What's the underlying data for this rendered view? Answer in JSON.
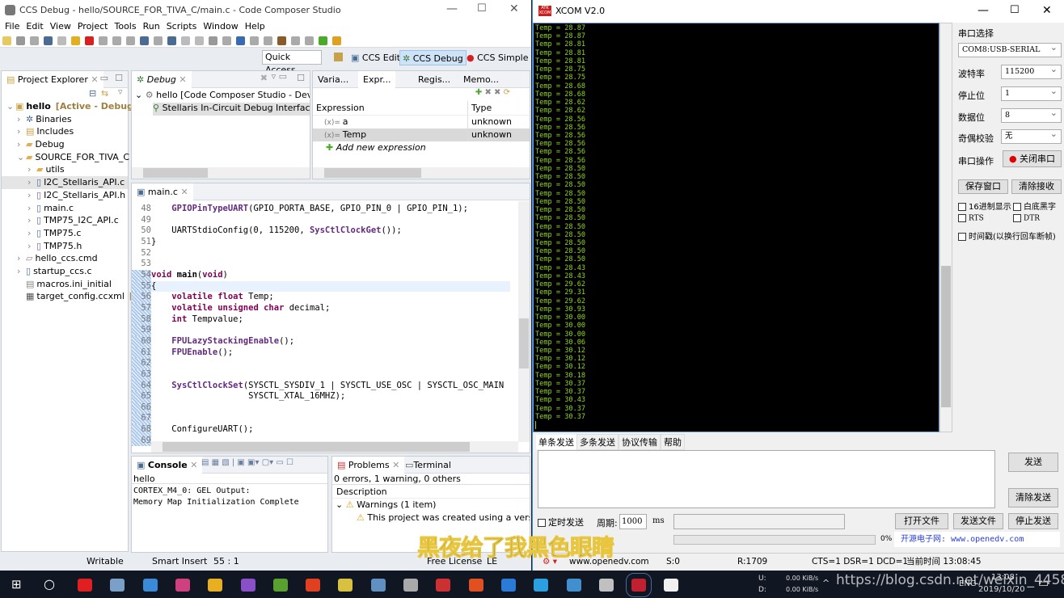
{
  "ccs": {
    "title": "CCS Debug - hello/SOURCE_FOR_TIVA_C/main.c - Code Composer Studio",
    "menu": [
      "File",
      "Edit",
      "View",
      "Project",
      "Tools",
      "Run",
      "Scripts",
      "Window",
      "Help"
    ],
    "quick_access": "Quick Access",
    "perspectives": [
      "CCS Edit",
      "CCS Debug",
      "CCS Simple"
    ],
    "project_explorer": {
      "title": "Project Explorer",
      "items": [
        {
          "label": "hello",
          "suffix": "[Active - Debug]",
          "level": 0,
          "expanded": true,
          "icon": "project-icon"
        },
        {
          "label": "Binaries",
          "level": 1,
          "icon": "binaries-icon"
        },
        {
          "label": "Includes",
          "level": 1,
          "icon": "includes-icon"
        },
        {
          "label": "Debug",
          "level": 1,
          "icon": "folder-icon"
        },
        {
          "label": "SOURCE_FOR_TIVA_C",
          "level": 1,
          "expanded": true,
          "icon": "folder-icon"
        },
        {
          "label": "utils",
          "level": 2,
          "icon": "folder-icon"
        },
        {
          "label": "I2C_Stellaris_API.c",
          "level": 2,
          "icon": "c-file-icon",
          "selected": true
        },
        {
          "label": "I2C_Stellaris_API.h",
          "level": 2,
          "icon": "h-file-icon"
        },
        {
          "label": "main.c",
          "level": 2,
          "icon": "c-file-icon"
        },
        {
          "label": "TMP75_I2C_API.c",
          "level": 2,
          "icon": "c-file-icon"
        },
        {
          "label": "TMP75.c",
          "level": 2,
          "icon": "c-file-icon"
        },
        {
          "label": "TMP75.h",
          "level": 2,
          "icon": "h-file-icon"
        },
        {
          "label": "hello_ccs.cmd",
          "level": 1,
          "icon": "cmd-file-icon"
        },
        {
          "label": "startup_ccs.c",
          "level": 1,
          "icon": "c-file-icon"
        },
        {
          "label": "macros.ini_initial",
          "level": 1,
          "icon": "file-icon",
          "noarrow": true
        },
        {
          "label": "target_config.ccxml",
          "suffix": "[A",
          "level": 1,
          "icon": "config-file-icon",
          "noarrow": true
        }
      ]
    },
    "debug": {
      "title": "Debug",
      "items": [
        "hello [Code Composer Studio - Device",
        "Stellaris In-Circuit Debug Interface_"
      ]
    },
    "views_tabs": [
      "Varia...",
      "Expr...",
      "Regis...",
      "Memo..."
    ],
    "expressions": {
      "headers": [
        "Expression",
        "Type"
      ],
      "rows": [
        {
          "name": "a",
          "type": "unknown"
        },
        {
          "name": "Temp",
          "type": "unknown"
        }
      ],
      "add": "Add new expression"
    },
    "editor": {
      "tab": "main.c",
      "lines": [
        {
          "n": "48",
          "s": [
            {
              "t": "    "
            },
            {
              "t": "GPIOPinTypeUART",
              "c": "fn"
            },
            {
              "t": "(GPIO_PORTA_BASE, GPIO_PIN_0 | GPIO_PIN_1);"
            }
          ]
        },
        {
          "n": "49",
          "s": []
        },
        {
          "n": "50",
          "s": [
            {
              "t": "    UARTStdioConfig(0, 115200, "
            },
            {
              "t": "SysCtlClockGet",
              "c": "fn"
            },
            {
              "t": "());"
            }
          ]
        },
        {
          "n": "51",
          "s": [
            {
              "t": "}"
            }
          ]
        },
        {
          "n": "52",
          "s": []
        },
        {
          "n": "53",
          "s": []
        },
        {
          "n": "54",
          "s": [
            {
              "t": "void",
              "c": "kw"
            },
            {
              "t": " "
            },
            {
              "t": "main",
              "c": "b"
            },
            {
              "t": "("
            },
            {
              "t": "void",
              "c": "kw"
            },
            {
              "t": ")"
            }
          ]
        },
        {
          "n": "55",
          "s": [
            {
              "t": "{"
            }
          ],
          "current": true
        },
        {
          "n": "56",
          "s": [
            {
              "t": "    "
            },
            {
              "t": "volatile",
              "c": "kw"
            },
            {
              "t": " "
            },
            {
              "t": "float",
              "c": "kw"
            },
            {
              "t": " Temp;"
            }
          ]
        },
        {
          "n": "57",
          "s": [
            {
              "t": "    "
            },
            {
              "t": "volatile",
              "c": "kw"
            },
            {
              "t": " "
            },
            {
              "t": "unsigned",
              "c": "kw"
            },
            {
              "t": " "
            },
            {
              "t": "char",
              "c": "kw"
            },
            {
              "t": " decimal;"
            }
          ]
        },
        {
          "n": "58",
          "s": [
            {
              "t": "    "
            },
            {
              "t": "int",
              "c": "kw"
            },
            {
              "t": " Tempvalue;"
            }
          ]
        },
        {
          "n": "59",
          "s": []
        },
        {
          "n": "60",
          "s": [
            {
              "t": "    "
            },
            {
              "t": "FPULazyStackingEnable",
              "c": "fn"
            },
            {
              "t": "();"
            }
          ]
        },
        {
          "n": "61",
          "s": [
            {
              "t": "    "
            },
            {
              "t": "FPUEnable",
              "c": "fn"
            },
            {
              "t": "();"
            }
          ]
        },
        {
          "n": "62",
          "s": []
        },
        {
          "n": "63",
          "s": []
        },
        {
          "n": "64",
          "s": [
            {
              "t": "    "
            },
            {
              "t": "SysCtlClockSet",
              "c": "fn"
            },
            {
              "t": "(SYSCTL_SYSDIV_1 | SYSCTL_USE_OSC | SYSCTL_OSC_MAIN |"
            }
          ]
        },
        {
          "n": "65",
          "s": [
            {
              "t": "                   SYSCTL_XTAL_16MHZ);"
            }
          ]
        },
        {
          "n": "66",
          "s": []
        },
        {
          "n": "67",
          "s": []
        },
        {
          "n": "68",
          "s": [
            {
              "t": "    ConfigureUART();"
            }
          ]
        },
        {
          "n": "69",
          "s": []
        }
      ]
    },
    "console": {
      "title": "Console",
      "name": "hello",
      "lines": [
        "CORTEX_M4_0: GEL Output:",
        "Memory Map Initialization Complete"
      ]
    },
    "problems": {
      "tabs": [
        "Problems",
        "Terminal"
      ],
      "summary": "0 errors, 1 warning, 0 others",
      "header": "Description",
      "group": "Warnings (1 item)",
      "item": "This project was created using a version"
    },
    "statusbar": {
      "writable": "Writable",
      "insert": "Smart Insert",
      "position": "55 : 1",
      "license": "Free License",
      "le": "LE"
    }
  },
  "xcom": {
    "title": "XCOM V2.0",
    "logo": "ATK XCOM",
    "received": [
      "28.87",
      "28.87",
      "28.81",
      "28.81",
      "28.81",
      "28.75",
      "28.75",
      "28.68",
      "28.68",
      "28.62",
      "28.62",
      "28.56",
      "28.56",
      "28.56",
      "28.56",
      "28.56",
      "28.56",
      "28.50",
      "28.50",
      "28.50",
      "28.50",
      "28.50",
      "28.50",
      "28.50",
      "28.50",
      "28.50",
      "28.50",
      "28.50",
      "28.50",
      "28.43",
      "28.43",
      "29.62",
      "29.31",
      "29.62",
      "30.93",
      "30.00",
      "30.00",
      "30.00",
      "30.06",
      "30.12",
      "30.12",
      "30.12",
      "30.18",
      "30.37",
      "30.37",
      "30.43",
      "30.37",
      "30.37"
    ],
    "line_prefix": "Temp = ",
    "settings": {
      "port_label": "串口选择",
      "port": "COM8:USB-SERIAL",
      "baud_label": "波特率",
      "baud": "115200",
      "stop_label": "停止位",
      "stop": "1",
      "data_label": "数据位",
      "data": "8",
      "parity_label": "奇偶校验",
      "parity": "无",
      "op_label": "串口操作",
      "op_button": "关闭串口",
      "save": "保存窗口",
      "clear_recv": "清除接收",
      "hex": "16进制显示",
      "white_bg": "白底黑字",
      "rts": "RTS",
      "dtr": "DTR",
      "timestamp": "时间戳(以换行回车断帧)"
    },
    "send_tabs": [
      "单条发送",
      "多条发送",
      "协议传输",
      "帮助"
    ],
    "send_button": "发送",
    "clear_send": "清除发送",
    "timed_send": "定时发送",
    "period_label": "周期:",
    "period": "1000",
    "ms": "ms",
    "open_file": "打开文件",
    "send_file": "发送文件",
    "stop_send": "停止发送",
    "progress": "0%",
    "progress_value": 0,
    "ad": "开源电子网: www.openedv.com",
    "status": {
      "site": "www.openedv.com",
      "sent": "S:0",
      "recv": "R:1709",
      "lines": "CTS=1 DSR=1 DCD=1",
      "time": "当前时间 13:08:45"
    }
  },
  "overlay": {
    "subtitle": "黑夜给了我黑色眼睛",
    "url_watermark": "https://blog.csdn.net/weixin_44587168"
  },
  "taskbar": {
    "net_up_label": "U:",
    "net_up": "0.00 KiB/s",
    "net_down_label": "D:",
    "net_down": "0.00 KiB/s",
    "time": "13:08",
    "date": "2019/10/20",
    "ime": "ENG"
  },
  "colors": {
    "terminal_text": "#8fd61e",
    "terminal_bg": "#000000",
    "active_perspective": "#cfe3f7"
  }
}
